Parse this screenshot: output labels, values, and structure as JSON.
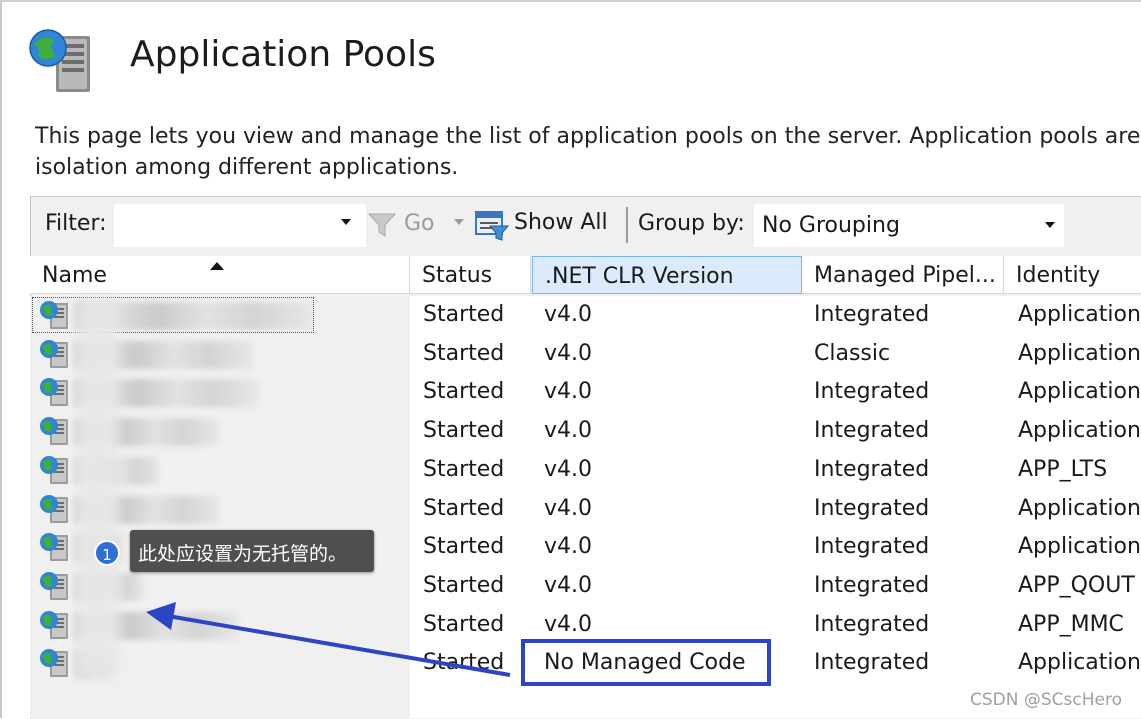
{
  "header": {
    "title": "Application Pools",
    "description_line1": "This page lets you view and manage the list of application pools on the server. Application pools are ass",
    "description_line2": "isolation among different applications."
  },
  "toolbar": {
    "filter_label": "Filter:",
    "filter_value": "",
    "go_label": "Go",
    "show_all_label": "Show All",
    "group_by_label": "Group by:",
    "group_by_value": "No Grouping"
  },
  "columns": [
    {
      "key": "name",
      "label": "Name"
    },
    {
      "key": "status",
      "label": "Status"
    },
    {
      "key": "clr",
      "label": ".NET CLR Version"
    },
    {
      "key": "pipeline",
      "label": "Managed Pipel..."
    },
    {
      "key": "identity",
      "label": "Identity"
    }
  ],
  "rows": [
    {
      "name": "",
      "status": "Started",
      "clr": "v4.0",
      "pipeline": "Integrated",
      "identity": "Application"
    },
    {
      "name": "",
      "status": "Started",
      "clr": "v4.0",
      "pipeline": "Classic",
      "identity": "Application"
    },
    {
      "name": "",
      "status": "Started",
      "clr": "v4.0",
      "pipeline": "Integrated",
      "identity": "Application"
    },
    {
      "name": "",
      "status": "Started",
      "clr": "v4.0",
      "pipeline": "Integrated",
      "identity": "Application"
    },
    {
      "name": "",
      "status": "Started",
      "clr": "v4.0",
      "pipeline": "Integrated",
      "identity": "APP_LTS"
    },
    {
      "name": "",
      "status": "Started",
      "clr": "v4.0",
      "pipeline": "Integrated",
      "identity": "Application"
    },
    {
      "name": "",
      "status": "Started",
      "clr": "v4.0",
      "pipeline": "Integrated",
      "identity": "Application"
    },
    {
      "name": "",
      "status": "Started",
      "clr": "v4.0",
      "pipeline": "Integrated",
      "identity": "APP_QOUT"
    },
    {
      "name": "",
      "status": "Started",
      "clr": "v4.0",
      "pipeline": "Integrated",
      "identity": "APP_MMC"
    },
    {
      "name": "",
      "status": "Started",
      "clr": "No Managed Code",
      "pipeline": "Integrated",
      "identity": "Application"
    }
  ],
  "annotation": {
    "number": "1",
    "text": "此处应设置为无托管的。"
  },
  "watermark": "CSDN @SCscHero",
  "colors": {
    "highlight_border": "#2b45c4",
    "callout_bg": "#4f4f4f",
    "callout_badge": "#2f6fd6",
    "active_header": "#dcebfb"
  }
}
